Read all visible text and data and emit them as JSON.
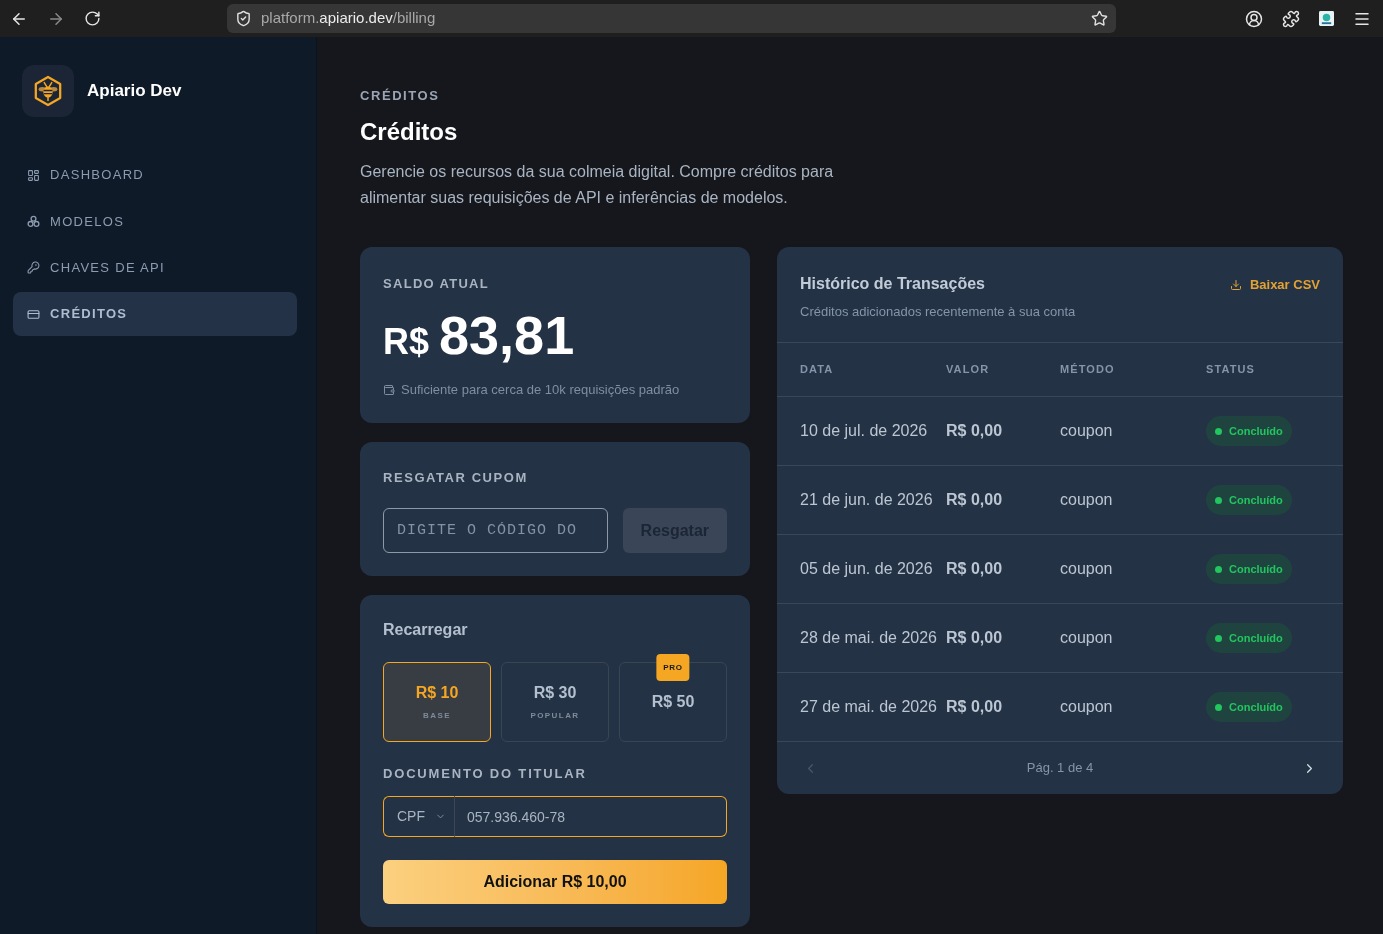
{
  "browser": {
    "url": {
      "subdomain": "platform.",
      "domain": "apiario.dev",
      "path": "/billing"
    }
  },
  "sidebar": {
    "brand": "Apiario Dev",
    "items": [
      {
        "label": "DASHBOARD",
        "selected": false
      },
      {
        "label": "MODELOS",
        "selected": false
      },
      {
        "label": "CHAVES DE API",
        "selected": false
      },
      {
        "label": "CRÉDITOS",
        "selected": true
      }
    ]
  },
  "header": {
    "eyebrow": "CRÉDITOS",
    "title": "Créditos",
    "description": "Gerencie os recursos da sua colmeia digital. Compre créditos para alimentar suas requisições de API e inferências de modelos."
  },
  "balance": {
    "label": "SALDO ATUAL",
    "currency": "R$",
    "amount": "83,81",
    "note": "Suficiente para cerca de 10k requisições padrão"
  },
  "coupon": {
    "label": "RESGATAR CUPOM",
    "placeholder": "DIGITE O CÓDIGO DO",
    "button": {
      "label": "Resgatar",
      "disabled": true
    }
  },
  "recharge": {
    "title": "Recarregar",
    "plans": [
      {
        "price": "R$ 10",
        "tier": "BASE",
        "selected": true
      },
      {
        "price": "R$ 30",
        "tier": "POPULAR",
        "selected": false
      },
      {
        "price": "R$ 50",
        "badge": "PRO",
        "selected": false
      }
    ],
    "document": {
      "label": "DOCUMENTO DO TITULAR",
      "type": "CPF",
      "value": "057.936.460-78"
    },
    "submit": "Adicionar R$ 10,00"
  },
  "history": {
    "title": "Histórico de Transações",
    "subtitle": "Créditos adicionados recentemente à sua conta",
    "export": "Baixar CSV",
    "columns": [
      "DATA",
      "VALOR",
      "MÉTODO",
      "STATUS"
    ],
    "rows": [
      {
        "date": "10 de jul. de 2026",
        "amount": "R$ 0,00",
        "method": "coupon",
        "status": "Concluído",
        "color": "#22c55e"
      },
      {
        "date": "21 de jun. de 2026",
        "amount": "R$ 0,00",
        "method": "coupon",
        "status": "Concluído",
        "color": "#22c55e"
      },
      {
        "date": "05 de jun. de 2026",
        "amount": "R$ 0,00",
        "method": "coupon",
        "status": "Concluído",
        "color": "#22c55e"
      },
      {
        "date": "28 de mai. de 2026",
        "amount": "R$ 0,00",
        "method": "coupon",
        "status": "Concluído",
        "color": "#22c55e"
      },
      {
        "date": "27 de mai. de 2026",
        "amount": "R$ 0,00",
        "method": "coupon",
        "status": "Concluído",
        "color": "#22c55e"
      }
    ],
    "pagination": {
      "label": "Pág. 1 de 4",
      "prev_disabled": true,
      "next_disabled": false
    }
  }
}
